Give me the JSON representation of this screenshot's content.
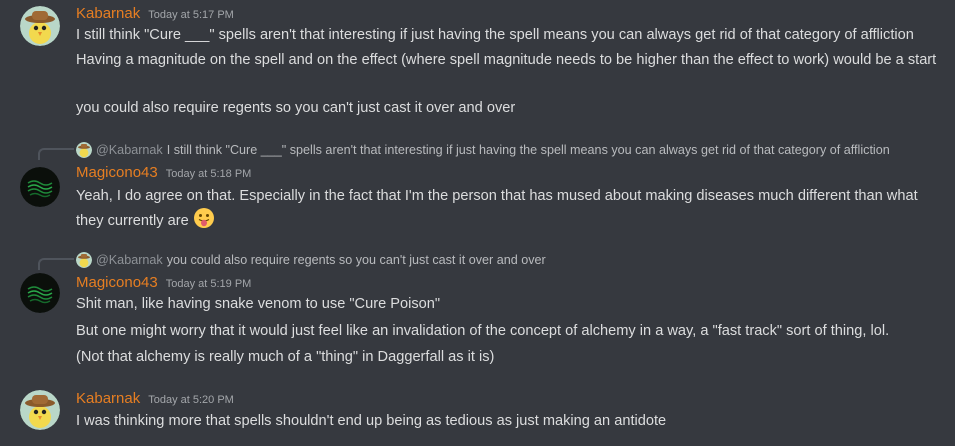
{
  "messages": [
    {
      "author": "Kabarnak",
      "timestamp": "Today at 5:17 PM",
      "avatar_icon": "cowboy-bird-avatar",
      "lines": [
        "I still think \"Cure ___\" spells aren't that interesting if just having the spell means you can always get rid of that category of affliction",
        "Having a magnitude on the spell and on the effect (where spell magnitude needs to be higher than the effect to work) would be a start",
        "you could also require regents so you can't just cast it over and over"
      ]
    },
    {
      "reply": {
        "mention": "@Kabarnak",
        "text": "I still think \"Cure ___\" spells aren't that interesting if just having the spell means you can always get rid of that category of affliction"
      },
      "author": "Magicono43",
      "timestamp": "Today at 5:18 PM",
      "avatar_icon": "dark-pattern-avatar",
      "lines": [
        "Yeah, I do agree on that. Especially in the fact that I'm the person that has mused about making diseases much different than what they currently are"
      ],
      "emoji": "tongue-out-emoji"
    },
    {
      "reply": {
        "mention": "@Kabarnak",
        "text": "you could also require regents so you can't just cast it over and over"
      },
      "author": "Magicono43",
      "timestamp": "Today at 5:19 PM",
      "avatar_icon": "dark-pattern-avatar",
      "lines": [
        "Shit man, like having snake venom to use \"Cure Poison\"",
        "But one might worry that it would just feel like an invalidation of the concept of alchemy in a way, a \"fast track\" sort of thing, lol.",
        "(Not that alchemy is really much of a \"thing\" in Daggerfall as it is)"
      ]
    },
    {
      "author": "Kabarnak",
      "timestamp": "Today at 5:20 PM",
      "avatar_icon": "cowboy-bird-avatar",
      "lines": [
        "I was thinking more that spells shouldn't end up being as tedious as just making an antidote"
      ]
    }
  ],
  "colors": {
    "background": "#36393f",
    "username": "#e67e22",
    "text": "#dcddde",
    "timestamp": "#a3a6aa"
  }
}
